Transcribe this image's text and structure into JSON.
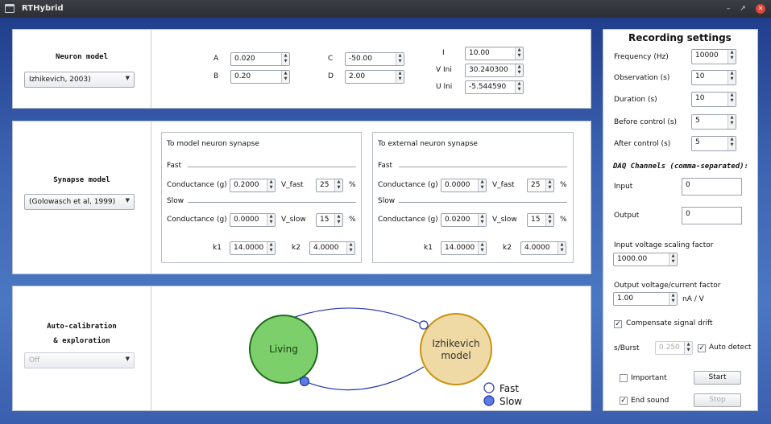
{
  "window": {
    "title": "RTHybrid",
    "minimize_glyph": "–",
    "restore_glyph": "↗",
    "close_glyph": "✕"
  },
  "neuron": {
    "header": "Neuron model",
    "model_select": "Izhikevich, 2003)",
    "params": [
      {
        "label": "A",
        "value": "0.020"
      },
      {
        "label": "B",
        "value": "0.20"
      },
      {
        "label": "C",
        "value": "-50.00"
      },
      {
        "label": "D",
        "value": "2.00"
      },
      {
        "label": "I",
        "value": "10.00"
      },
      {
        "label": "V Ini",
        "value": "30.240300"
      },
      {
        "label": "U Ini",
        "value": "-5.544590"
      }
    ]
  },
  "synapse": {
    "header": "Synapse model",
    "model_select": "(Golowasch et al, 1999)",
    "model_side": {
      "title": "To model neuron synapse",
      "fast_label": "Fast",
      "slow_label": "Slow",
      "conductance_label": "Conductance (g)",
      "fast_conductance": "0.2000",
      "vfast_label": "V_fast",
      "vfast_value": "25",
      "slow_conductance": "0.0000",
      "vslow_label": "V_slow",
      "vslow_value": "15",
      "percent": "%",
      "k1_label": "k1",
      "k1_value": "14.0000",
      "k2_label": "k2",
      "k2_value": "4.0000"
    },
    "external_side": {
      "title": "To external neuron synapse",
      "fast_label": "Fast",
      "slow_label": "Slow",
      "conductance_label": "Conductance (g)",
      "fast_conductance": "0.0000",
      "vfast_label": "V_fast",
      "vfast_value": "25",
      "slow_conductance": "0.0200",
      "vslow_label": "V_slow",
      "vslow_value": "15",
      "percent": "%",
      "k1_label": "k1",
      "k1_value": "14.0000",
      "k2_label": "k2",
      "k2_value": "4.0000"
    }
  },
  "autocal": {
    "header_line1": "Auto-calibration",
    "header_line2": "& exploration",
    "select": "Off"
  },
  "diagram": {
    "living_label": "Living",
    "model_label_line1": "Izhikevich",
    "model_label_line2": "model",
    "legend_fast": "Fast",
    "legend_slow": "Slow",
    "living_color": "#7ccf6a",
    "model_color": "#efd9a5",
    "connection_color": "#2233aa",
    "slow_color": "#5a7be0"
  },
  "recording": {
    "title": "Recording settings",
    "fields": [
      {
        "label": "Frequency (Hz)",
        "value": "10000"
      },
      {
        "label": "Observation (s)",
        "value": "10"
      },
      {
        "label": "Duration  (s)",
        "value": "10"
      },
      {
        "label": "Before control (s)",
        "value": "5"
      },
      {
        "label": "After control (s)",
        "value": "5"
      }
    ],
    "daq_title": "DAQ Channels (comma-separated):",
    "input_label": "Input",
    "input_value": "0",
    "output_label": "Output",
    "output_value": "0",
    "input_scaling_label": "Input voltage scaling factor",
    "input_scaling_value": "1000.00",
    "output_factor_label": "Output voltage/current factor",
    "output_factor_value": "1.00",
    "output_factor_unit": "nA / V",
    "compensate_label": "Compensate signal drift",
    "compensate_checked": true,
    "sburst_label": "s/Burst",
    "sburst_value": "0.250",
    "auto_detect_label": "Auto detect",
    "auto_detect_checked": true,
    "important_label": "Important",
    "important_checked": false,
    "end_sound_label": "End sound",
    "end_sound_checked": true,
    "start_label": "Start",
    "stop_label": "Stop"
  }
}
